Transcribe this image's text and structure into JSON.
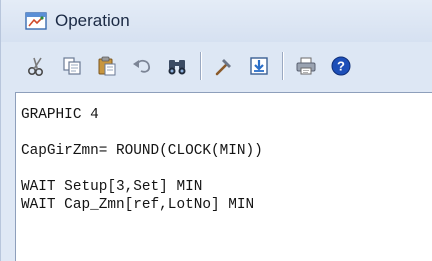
{
  "window": {
    "title": "Operation",
    "icon": "operation-window-icon"
  },
  "toolbar": {
    "buttons": [
      {
        "name": "cut",
        "icon": "scissors-icon"
      },
      {
        "name": "copy",
        "icon": "copy-icon"
      },
      {
        "name": "paste",
        "icon": "clipboard-paste-icon"
      },
      {
        "name": "undo",
        "icon": "undo-arrow-icon"
      },
      {
        "name": "find",
        "icon": "binoculars-icon"
      },
      {
        "name": "build",
        "icon": "hammer-icon"
      },
      {
        "name": "import",
        "icon": "download-arrow-icon"
      },
      {
        "name": "print",
        "icon": "printer-icon"
      },
      {
        "name": "help",
        "icon": "help-icon"
      }
    ]
  },
  "editor": {
    "lines": [
      "GRAPHIC 4",
      "",
      "CapGirZmn= ROUND(CLOCK(MIN))",
      "",
      "WAIT Setup[3,Set] MIN",
      "WAIT Cap_Zmn[ref,LotNo] MIN"
    ]
  },
  "colors": {
    "chrome": "#dfe8f5",
    "editor_bg": "#ffffff",
    "text": "#141414",
    "help_blue": "#1d4fb8"
  }
}
